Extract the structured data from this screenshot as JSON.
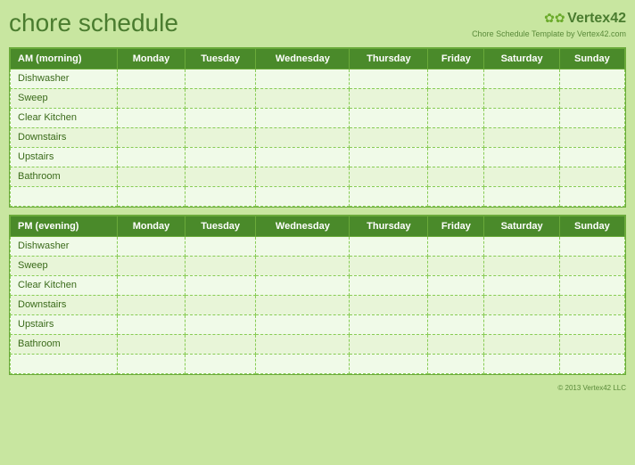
{
  "title": "chore schedule",
  "logo": {
    "icon": "❧",
    "brand": "Vertex42",
    "subtitle": "Chore Schedule Template by Vertex42.com"
  },
  "am_table": {
    "header_label": "AM (morning)",
    "days": [
      "Monday",
      "Tuesday",
      "Wednesday",
      "Thursday",
      "Friday",
      "Saturday",
      "Sunday"
    ],
    "chores": [
      "Dishwasher",
      "Sweep",
      "Clear Kitchen",
      "Downstairs",
      "Upstairs",
      "Bathroom",
      ""
    ]
  },
  "pm_table": {
    "header_label": "PM (evening)",
    "days": [
      "Monday",
      "Tuesday",
      "Wednesday",
      "Thursday",
      "Friday",
      "Saturday",
      "Sunday"
    ],
    "chores": [
      "Dishwasher",
      "Sweep",
      "Clear Kitchen",
      "Downstairs",
      "Upstairs",
      "Bathroom",
      ""
    ]
  },
  "footer": "© 2013 Vertex42 LLC"
}
